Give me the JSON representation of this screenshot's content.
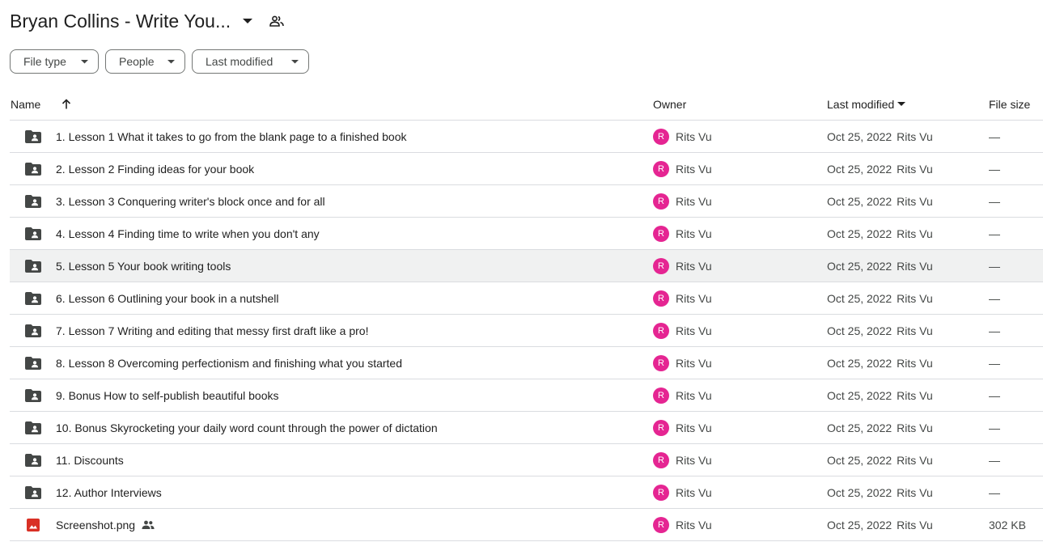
{
  "header": {
    "title": "Bryan Collins - Write You...",
    "caret_icon": "arrow-drop-down-icon",
    "share_icon": "people-outline-icon"
  },
  "filters": [
    {
      "label": "File type"
    },
    {
      "label": "People"
    },
    {
      "label": "Last modified"
    }
  ],
  "columns": {
    "name": "Name",
    "owner": "Owner",
    "modified": "Last modified",
    "size": "File size"
  },
  "colors": {
    "avatar": "#e52592",
    "folder": "#444746",
    "image_icon": "#d93025",
    "row_hover": "#f0f1f1"
  },
  "rows": [
    {
      "name": "1. Lesson 1 What it takes to go from the blank page to a finished book",
      "type": "shared-folder",
      "owner_initial": "R",
      "owner": "Rits Vu",
      "modified_date": "Oct 25, 2022",
      "modified_by": "Rits Vu",
      "size": "—"
    },
    {
      "name": "2. Lesson 2 Finding ideas for your book",
      "type": "shared-folder",
      "owner_initial": "R",
      "owner": "Rits Vu",
      "modified_date": "Oct 25, 2022",
      "modified_by": "Rits Vu",
      "size": "—"
    },
    {
      "name": "3. Lesson 3 Conquering writer's block once and for all",
      "type": "shared-folder",
      "owner_initial": "R",
      "owner": "Rits Vu",
      "modified_date": "Oct 25, 2022",
      "modified_by": "Rits Vu",
      "size": "—"
    },
    {
      "name": "4. Lesson 4 Finding time to write when you don't any",
      "type": "shared-folder",
      "owner_initial": "R",
      "owner": "Rits Vu",
      "modified_date": "Oct 25, 2022",
      "modified_by": "Rits Vu",
      "size": "—"
    },
    {
      "name": "5. Lesson 5 Your book writing tools",
      "type": "shared-folder",
      "owner_initial": "R",
      "owner": "Rits Vu",
      "modified_date": "Oct 25, 2022",
      "modified_by": "Rits Vu",
      "size": "—"
    },
    {
      "name": "6. Lesson 6 Outlining your book in a nutshell",
      "type": "shared-folder",
      "owner_initial": "R",
      "owner": "Rits Vu",
      "modified_date": "Oct 25, 2022",
      "modified_by": "Rits Vu",
      "size": "—"
    },
    {
      "name": "7. Lesson 7 Writing and editing that messy first draft like a pro!",
      "type": "shared-folder",
      "owner_initial": "R",
      "owner": "Rits Vu",
      "modified_date": "Oct 25, 2022",
      "modified_by": "Rits Vu",
      "size": "—"
    },
    {
      "name": "8. Lesson 8 Overcoming perfectionism and finishing what you started",
      "type": "shared-folder",
      "owner_initial": "R",
      "owner": "Rits Vu",
      "modified_date": "Oct 25, 2022",
      "modified_by": "Rits Vu",
      "size": "—"
    },
    {
      "name": "9. Bonus How to self-publish beautiful books",
      "type": "shared-folder",
      "owner_initial": "R",
      "owner": "Rits Vu",
      "modified_date": "Oct 25, 2022",
      "modified_by": "Rits Vu",
      "size": "—"
    },
    {
      "name": "10. Bonus Skyrocketing your daily word count through the power of dictation",
      "type": "shared-folder",
      "owner_initial": "R",
      "owner": "Rits Vu",
      "modified_date": "Oct 25, 2022",
      "modified_by": "Rits Vu",
      "size": "—"
    },
    {
      "name": "11. Discounts",
      "type": "shared-folder",
      "owner_initial": "R",
      "owner": "Rits Vu",
      "modified_date": "Oct 25, 2022",
      "modified_by": "Rits Vu",
      "size": "—"
    },
    {
      "name": "12. Author Interviews",
      "type": "shared-folder",
      "owner_initial": "R",
      "owner": "Rits Vu",
      "modified_date": "Oct 25, 2022",
      "modified_by": "Rits Vu",
      "size": "—"
    },
    {
      "name": "Screenshot.png",
      "type": "image",
      "shared": true,
      "owner_initial": "R",
      "owner": "Rits Vu",
      "modified_date": "Oct 25, 2022",
      "modified_by": "Rits Vu",
      "size": "302 KB"
    }
  ]
}
